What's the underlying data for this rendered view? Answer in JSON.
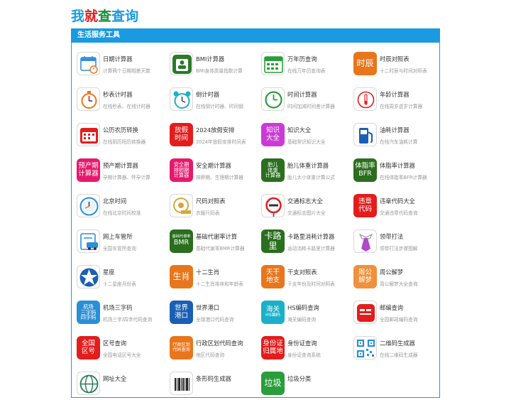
{
  "site": {
    "logo_chars": [
      "我",
      "就",
      "查",
      "查",
      "询"
    ],
    "logo_colors": [
      "#1a9ae0",
      "#e31d1c",
      "#1a8f3c",
      "#1a9ae0",
      "#1a9ae0"
    ]
  },
  "section": {
    "title": "生活服务工具"
  },
  "tools": [
    {
      "title": "日期计算器",
      "desc": "计算两个日期相差天数",
      "icon": "calendar-icon"
    },
    {
      "title": "BMI计算器",
      "desc": "BMI身体质量指数计算",
      "icon": "scale-icon"
    },
    {
      "title": "万年历查询",
      "desc": "在线万年历查询表",
      "icon": "calendar-grid-icon"
    },
    {
      "title": "时辰对照表",
      "desc": "十二时辰与时间对照表",
      "icon": "shichen-icon",
      "box": [
        "时辰"
      ],
      "color": "#e8761c"
    },
    {
      "title": "秒表计时器",
      "desc": "在线秒表、在线计时器",
      "icon": "stopwatch-icon"
    },
    {
      "title": "倒计时器",
      "desc": "在线倒计时器、时间倒",
      "icon": "alarm-clock-icon"
    },
    {
      "title": "时间计算器",
      "desc": "时间加减时间差计算器",
      "icon": "clock-icon"
    },
    {
      "title": "年龄计算器",
      "desc": "在线周岁虚岁计算器",
      "icon": "age-icon"
    },
    {
      "title": "公历农历转换",
      "desc": "在线阴历阳历转换器",
      "icon": "lunar-calendar-icon"
    },
    {
      "title": "2024放假安排",
      "desc": "2024年放假安排时间表",
      "icon": "holiday-icon",
      "box": [
        "放假",
        "时间"
      ],
      "color": "#e31d1c"
    },
    {
      "title": "知识大全",
      "desc": "基础常识知识大全",
      "icon": "knowledge-icon",
      "box": [
        "知识",
        "大全"
      ],
      "color": "#cc3ad6"
    },
    {
      "title": "油耗计算器",
      "desc": "在线汽车油耗计算",
      "icon": "fuel-pump-icon"
    },
    {
      "title": "预产期计算器",
      "desc": "孕期计算器、怀孕计算",
      "icon": "due-date-icon",
      "box": [
        "预产期",
        "计算器"
      ],
      "color": "#e8186c"
    },
    {
      "title": "安全期计算器",
      "desc": "排卵期、生理期计算器",
      "icon": "safe-period-icon",
      "box": [
        "安全期",
        "排卵期",
        "计算器"
      ],
      "color": "#e8186c"
    },
    {
      "title": "胎儿体重计算器",
      "desc": "胎儿大小体重计算公式",
      "icon": "fetal-weight-icon",
      "box": [
        "胎儿",
        "体重",
        "计算器"
      ],
      "color": "#2a6e1e"
    },
    {
      "title": "体脂率计算器",
      "desc": "在线体脂率BFR计算器",
      "icon": "bfr-icon",
      "box": [
        "体脂率",
        "BFR"
      ],
      "color": "#2a6e1e"
    },
    {
      "title": "北京时间",
      "desc": "在线北京时间校准",
      "icon": "beijing-clock-icon"
    },
    {
      "title": "尺码对照表",
      "desc": "衣服尺码表",
      "icon": "tape-measure-icon"
    },
    {
      "title": "交通标志大全",
      "desc": "交通标志图片大全",
      "icon": "traffic-sign-icon"
    },
    {
      "title": "违章代码大全",
      "desc": "交通违章代码查询",
      "icon": "violation-icon",
      "box": [
        "违章",
        "代码"
      ],
      "color": "#e31d1c"
    },
    {
      "title": "网上车管所",
      "desc": "全国车管所查询",
      "icon": "car-office-icon"
    },
    {
      "title": "基础代谢率计算",
      "desc": "基础代谢率BMR计算器",
      "icon": "bmr-icon",
      "box": [
        "基础代谢率",
        "BMR"
      ],
      "color": "#2a6e1e"
    },
    {
      "title": "卡路里消耗计算器",
      "desc": "运动消耗卡路里计算器",
      "icon": "calorie-icon",
      "box": [
        "卡路里"
      ],
      "color": "#2a6e1e"
    },
    {
      "title": "领带打法",
      "desc": "领带打法步骤图解",
      "icon": "tie-icon"
    },
    {
      "title": "星座",
      "desc": "十二星座月份表",
      "icon": "star-icon"
    },
    {
      "title": "十二生肖",
      "desc": "十二生肖排序和年龄表",
      "icon": "zodiac-icon",
      "box": [
        "生肖"
      ],
      "color": "#e8761c"
    },
    {
      "title": "干支对照表",
      "desc": "干支年份及时间对照表",
      "icon": "ganzhi-icon",
      "box": [
        "天干",
        "地支"
      ],
      "color": "#e8761c"
    },
    {
      "title": "周公解梦",
      "desc": "周公解梦大全查询",
      "icon": "dream-icon",
      "box": [
        "周公",
        "解梦"
      ],
      "color": "#f0903a"
    },
    {
      "title": "机场三字码",
      "desc": "机场三字/四字代码查询",
      "icon": "airport-icon",
      "box": [
        "机场",
        "三字码",
        "四字码"
      ],
      "color": "#2a8fd6"
    },
    {
      "title": "世界港口",
      "desc": "全球港口代码查询",
      "icon": "port-icon",
      "box": [
        "世界",
        "港口"
      ],
      "color": "#1a5fb4"
    },
    {
      "title": "HS编码查询",
      "desc": "海关编码查询",
      "icon": "hs-code-icon",
      "box": [
        "海关",
        "HS编码"
      ],
      "color": "#1ab0c8"
    },
    {
      "title": "邮编查询",
      "desc": "全国邮政编码查询",
      "icon": "postcode-icon"
    },
    {
      "title": "区号查询",
      "desc": "全国电话区号大全",
      "icon": "area-code-icon",
      "box": [
        "全国",
        "区号"
      ],
      "color": "#e31d1c"
    },
    {
      "title": "行政区划代码查询",
      "desc": "地区代码查询",
      "icon": "division-code-icon",
      "box": [
        "行政区划",
        "代码查询"
      ],
      "color": "#e8761c"
    },
    {
      "title": "身份证查询",
      "desc": "身份证查询系统",
      "icon": "id-card-icon",
      "box": [
        "身份证",
        "归属地"
      ],
      "color": "#e31d1c"
    },
    {
      "title": "二维码生成器",
      "desc": "在线二维码生成器",
      "icon": "qrcode-icon"
    },
    {
      "title": "网址大全",
      "desc": "",
      "icon": "globe-icon"
    },
    {
      "title": "条形码生成器",
      "desc": "",
      "icon": "barcode-icon"
    },
    {
      "title": "垃圾分类",
      "desc": "",
      "icon": "garbage-icon",
      "box": [
        "垃圾"
      ],
      "color": "#2a9e3a"
    }
  ]
}
